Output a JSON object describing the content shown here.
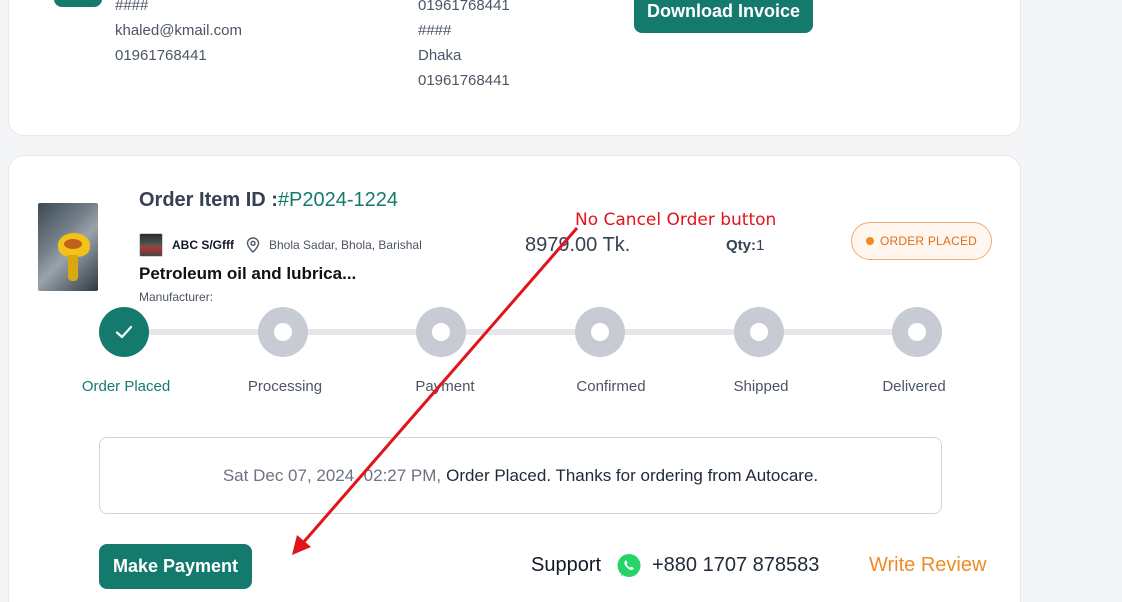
{
  "top_card": {
    "billing": {
      "line_masked": "####",
      "email": "khaled@kmail.com",
      "phone": "01961768441"
    },
    "shipping": {
      "phone_top": "01961768441",
      "line_masked": "####",
      "city": "Dhaka",
      "phone": "01961768441"
    },
    "download_invoice_label": "Download Invoice"
  },
  "order": {
    "title_label": "Order Item ID :",
    "item_id": "#P2024-1224",
    "shop_name": "ABC S/Gfff",
    "shop_location": "Bhola Sadar, Bhola, Barishal",
    "product_name": "Petroleum oil and lubrica...",
    "manufacturer_label": "Manufacturer:",
    "price": "8979.00 Tk.",
    "qty_label": "Qty:",
    "qty_value": "1",
    "status": "ORDER PLACED",
    "steps": [
      {
        "label": "Order Placed",
        "done": true
      },
      {
        "label": "Processing",
        "done": false
      },
      {
        "label": "Payment",
        "done": false
      },
      {
        "label": "Confirmed",
        "done": false
      },
      {
        "label": "Shipped",
        "done": false
      },
      {
        "label": "Delivered",
        "done": false
      }
    ],
    "message_time": "Sat Dec 07, 2024, 02:27 PM,",
    "message_text": "Order Placed. Thanks for ordering from Autocare.",
    "make_payment_label": "Make Payment",
    "support_label": "Support",
    "support_phone": "+880 1707 878583",
    "write_review_label": "Write Review"
  },
  "annotation": {
    "text": "No Cancel Order button"
  },
  "icons": {
    "whatsapp": "whatsapp-icon",
    "pin": "location-pin-icon",
    "check": "check-icon"
  },
  "colors": {
    "primary": "#157a6e",
    "accent": "#f08a24",
    "annotation": "#e0141a"
  }
}
